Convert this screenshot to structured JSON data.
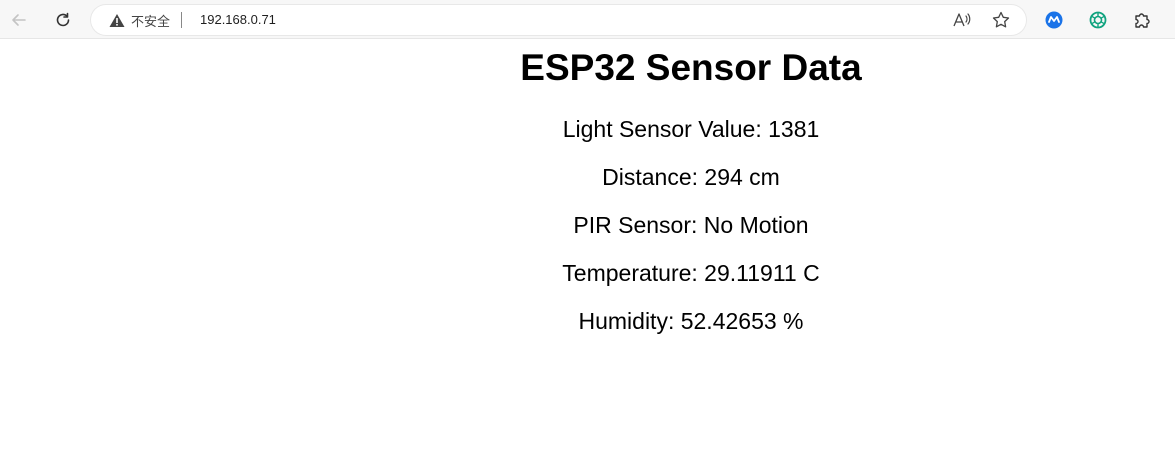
{
  "browser": {
    "address_bar": {
      "security_label": "不安全",
      "url": "192.168.0.71"
    },
    "icons": {
      "back": "back-arrow-icon",
      "reload": "reload-icon",
      "warning": "warning-triangle-icon",
      "read_aloud": "read-aloud-icon",
      "favorite": "star-icon",
      "extension_1": "blue-extension-icon",
      "extension_2": "green-openai-icon",
      "extensions": "puzzle-icon"
    },
    "colors": {
      "warning": "#444444",
      "extension_blue": "#1a73e8",
      "extension_green": "#10a37f"
    }
  },
  "page": {
    "title": "ESP32 Sensor Data",
    "readings": {
      "light": "Light Sensor Value: 1381",
      "distance": "Distance: 294 cm",
      "pir": "PIR Sensor: No Motion",
      "temperature": "Temperature: 29.11911 C",
      "humidity": "Humidity: 52.42653 %"
    }
  }
}
